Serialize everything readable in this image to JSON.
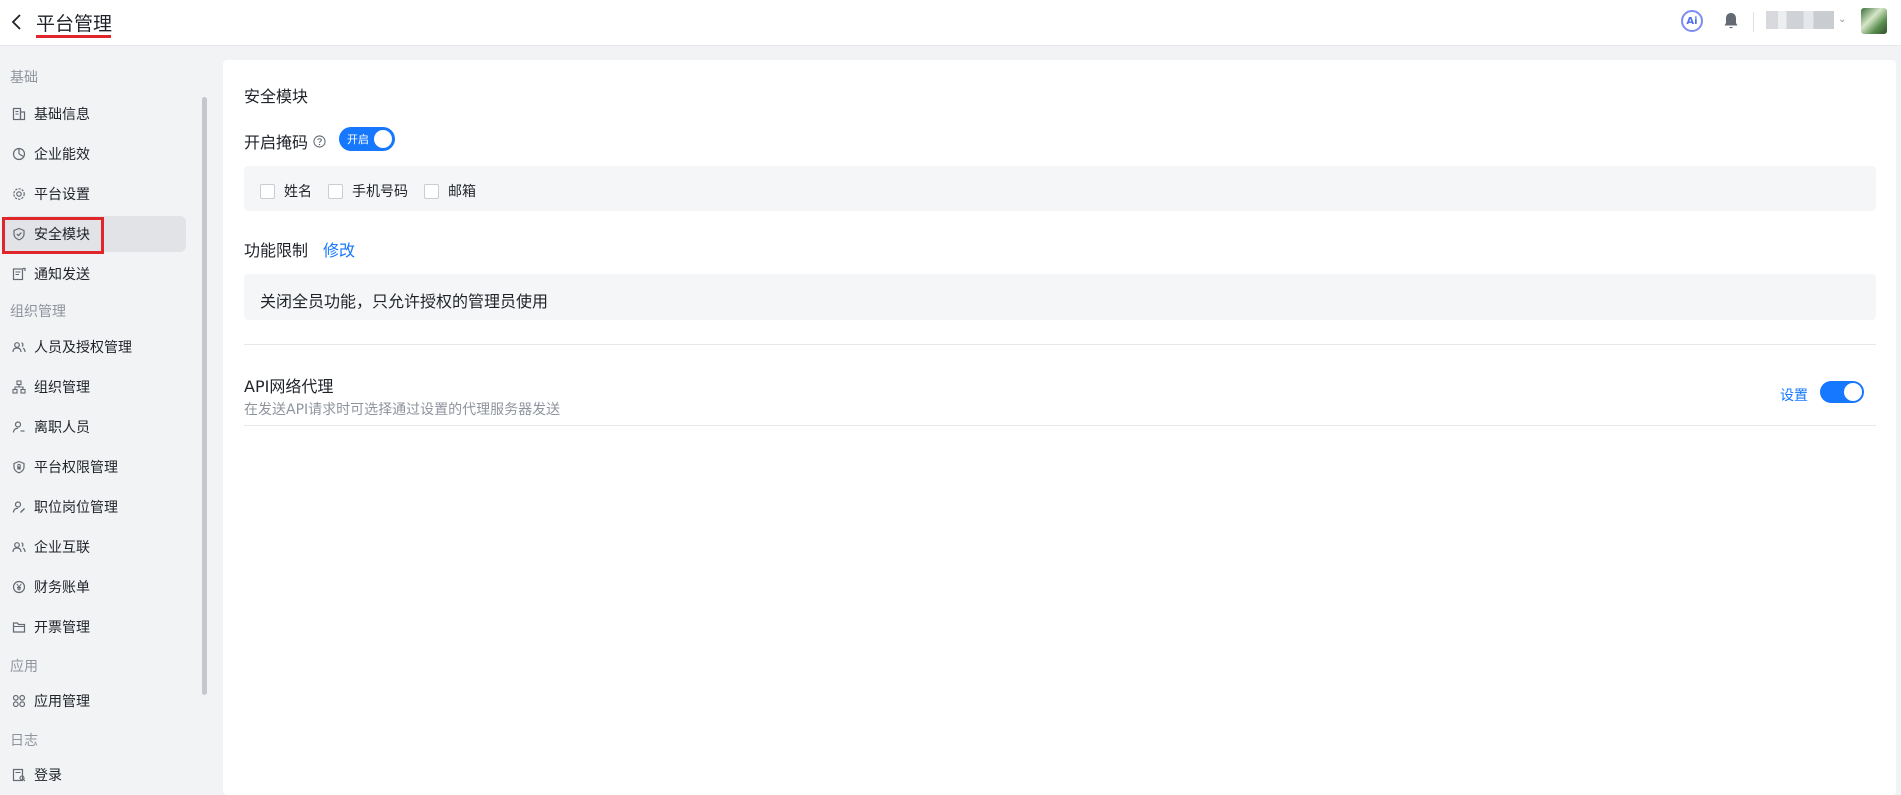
{
  "header": {
    "title": "平台管理",
    "ai_label": "Ai"
  },
  "sidebar": {
    "groups": [
      {
        "label": "基础"
      },
      {
        "label": "组织管理"
      },
      {
        "label": "应用"
      },
      {
        "label": "日志"
      }
    ],
    "items": [
      {
        "label": "基础信息",
        "icon": "building-icon"
      },
      {
        "label": "企业能效",
        "icon": "chart-pie-icon"
      },
      {
        "label": "平台设置",
        "icon": "gear-icon"
      },
      {
        "label": "安全模块",
        "icon": "shield-icon",
        "active": true
      },
      {
        "label": "通知发送",
        "icon": "notice-icon"
      },
      {
        "label": "人员及授权管理",
        "icon": "users-icon"
      },
      {
        "label": "组织管理",
        "icon": "org-tree-icon"
      },
      {
        "label": "离职人员",
        "icon": "user-leave-icon"
      },
      {
        "label": "平台权限管理",
        "icon": "shield-lock-icon"
      },
      {
        "label": "职位岗位管理",
        "icon": "user-edit-icon"
      },
      {
        "label": "企业互联",
        "icon": "users-link-icon"
      },
      {
        "label": "财务账单",
        "icon": "yen-icon"
      },
      {
        "label": "开票管理",
        "icon": "folder-icon"
      },
      {
        "label": "应用管理",
        "icon": "apps-grid-icon"
      },
      {
        "label": "登录",
        "icon": "login-log-icon"
      }
    ]
  },
  "main": {
    "title": "安全模块",
    "mask": {
      "label": "开启掩码",
      "toggle_text": "开启",
      "enabled": true,
      "options": [
        {
          "label": "姓名",
          "checked": false
        },
        {
          "label": "手机号码",
          "checked": false
        },
        {
          "label": "邮箱",
          "checked": false
        }
      ]
    },
    "func_limit": {
      "label": "功能限制",
      "edit_label": "修改",
      "description": "关闭全员功能，只允许授权的管理员使用"
    },
    "api_proxy": {
      "title": "API网络代理",
      "description": "在发送API请求时可选择通过设置的代理服务器发送",
      "setting_label": "设置",
      "enabled": true
    }
  },
  "colors": {
    "accent": "#1677ff",
    "highlight": "#e0262b"
  }
}
